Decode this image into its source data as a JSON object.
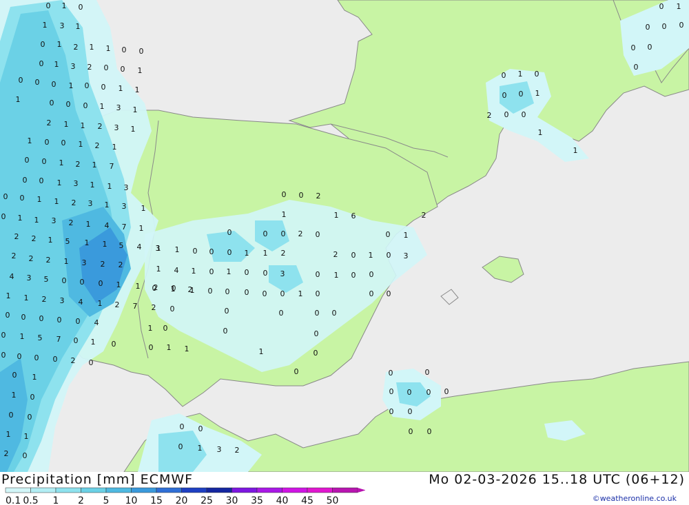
{
  "header": {
    "left_title": "Precipitation [mm] ECMWF",
    "right_title": "Mo 02-03-2026 15..18 UTC (06+12)",
    "credit": "©weatheronline.co.uk"
  },
  "legend": {
    "ticks": [
      "0.1",
      "0.5",
      "1",
      "2",
      "5",
      "10",
      "15",
      "20",
      "25",
      "30",
      "35",
      "40",
      "45",
      "50"
    ],
    "colors": [
      "#d2f6f8",
      "#b2eef4",
      "#8ee2ee",
      "#6bd1e6",
      "#4fb9e1",
      "#3a9adc",
      "#2f6fd6",
      "#1e3fc2",
      "#1426a0",
      "#7d16e0",
      "#a918e6",
      "#cf14e4",
      "#e016cf",
      "#b814b0"
    ]
  },
  "colors": {
    "sea": "#ececec",
    "land": "#c8f4a4",
    "coast": "#888888",
    "border": "#8a8a8a"
  },
  "map_labels": [
    "0",
    "1",
    "0",
    "1",
    "3",
    "1",
    "0",
    "1",
    "2",
    "1",
    "1",
    "0",
    "0",
    "0",
    "1",
    "3",
    "2",
    "0",
    "0",
    "1",
    "0",
    "0",
    "0",
    "1",
    "0",
    "0",
    "1",
    "1",
    "1",
    "0",
    "0",
    "0",
    "1",
    "3",
    "1",
    "2",
    "1",
    "1",
    "2",
    "3",
    "1",
    "1",
    "0",
    "0",
    "1",
    "2",
    "1",
    "0",
    "0",
    "1",
    "2",
    "1",
    "7",
    "0",
    "0",
    "1",
    "3",
    "1",
    "1",
    "3",
    "0",
    "0",
    "1",
    "1",
    "2",
    "3",
    "1",
    "3",
    "1",
    "0",
    "1",
    "1",
    "3",
    "2",
    "1",
    "4",
    "7",
    "1",
    "2",
    "2",
    "1",
    "5",
    "1",
    "1",
    "5",
    "4",
    "3",
    "2",
    "2",
    "2",
    "1",
    "3",
    "2",
    "2",
    "4",
    "3",
    "5",
    "0",
    "0",
    "0",
    "1",
    "1",
    "2",
    "0",
    "2",
    "1",
    "1",
    "2",
    "3",
    "4",
    "1",
    "2",
    "7",
    "2",
    "0",
    "0",
    "0",
    "0",
    "0",
    "0",
    "4",
    "0",
    "1",
    "5",
    "7",
    "0",
    "1",
    "0",
    "0",
    "0",
    "0",
    "0",
    "2",
    "0",
    "0",
    "1",
    "1",
    "0",
    "0",
    "0",
    "1",
    "1",
    "2",
    "0",
    "1",
    "1",
    "0",
    "0",
    "0",
    "1",
    "0",
    "0",
    "2",
    "0",
    "1",
    "2",
    "0",
    "0",
    "0",
    "2",
    "1",
    "6",
    "1",
    "2",
    "0",
    "1",
    "0",
    "3",
    "0",
    "1",
    "2",
    "1",
    "4",
    "1",
    "0",
    "1",
    "0",
    "0",
    "3",
    "0",
    "1",
    "0",
    "0",
    "0",
    "0",
    "0",
    "1",
    "0",
    "0",
    "0",
    "0",
    "0",
    "1",
    "1",
    "0",
    "0",
    "0",
    "0",
    "0",
    "0",
    "0",
    "1",
    "0",
    "0",
    "1",
    "0",
    "0",
    "1",
    "1",
    "0",
    "0",
    "0",
    "1",
    "3",
    "2",
    "0",
    "0",
    "0",
    "0",
    "0",
    "0",
    "0",
    "0",
    "0",
    "0",
    "0",
    "1",
    "0",
    "0",
    "0",
    "1",
    "2",
    "0",
    "0",
    "1",
    "1",
    "0",
    "1",
    "0",
    "0",
    "0",
    "0",
    "0",
    "0"
  ]
}
